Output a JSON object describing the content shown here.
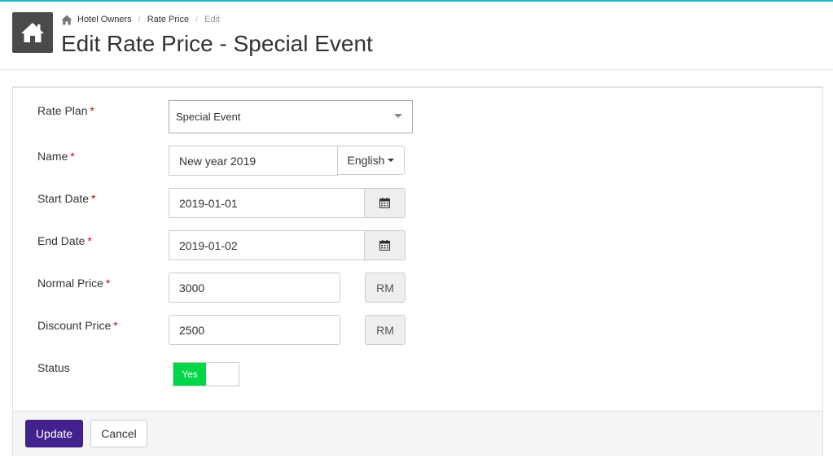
{
  "breadcrumb": {
    "items": [
      "Hotel Owners",
      "Rate Price"
    ],
    "active": "Edit"
  },
  "page": {
    "title": "Edit Rate Price - Special Event"
  },
  "form": {
    "rate_plan": {
      "label": "Rate Plan",
      "value": "Special Event"
    },
    "name": {
      "label": "Name",
      "value": "New year 2019",
      "language": "English"
    },
    "start_date": {
      "label": "Start Date",
      "value": "2019-01-01"
    },
    "end_date": {
      "label": "End Date",
      "value": "2019-01-02"
    },
    "normal_price": {
      "label": "Normal Price",
      "value": "3000",
      "currency": "RM"
    },
    "discount_price": {
      "label": "Discount Price",
      "value": "2500",
      "currency": "RM"
    },
    "status": {
      "label": "Status",
      "value": "Yes"
    },
    "required_mark": "*"
  },
  "buttons": {
    "update": "Update",
    "cancel": "Cancel"
  },
  "icons": {
    "home": "home-icon",
    "calendar": "calendar-icon"
  },
  "colors": {
    "accent_line": "#1bb8c4",
    "primary_button": "#44228e",
    "toggle_on": "#00d646",
    "required": "#d0021b"
  }
}
